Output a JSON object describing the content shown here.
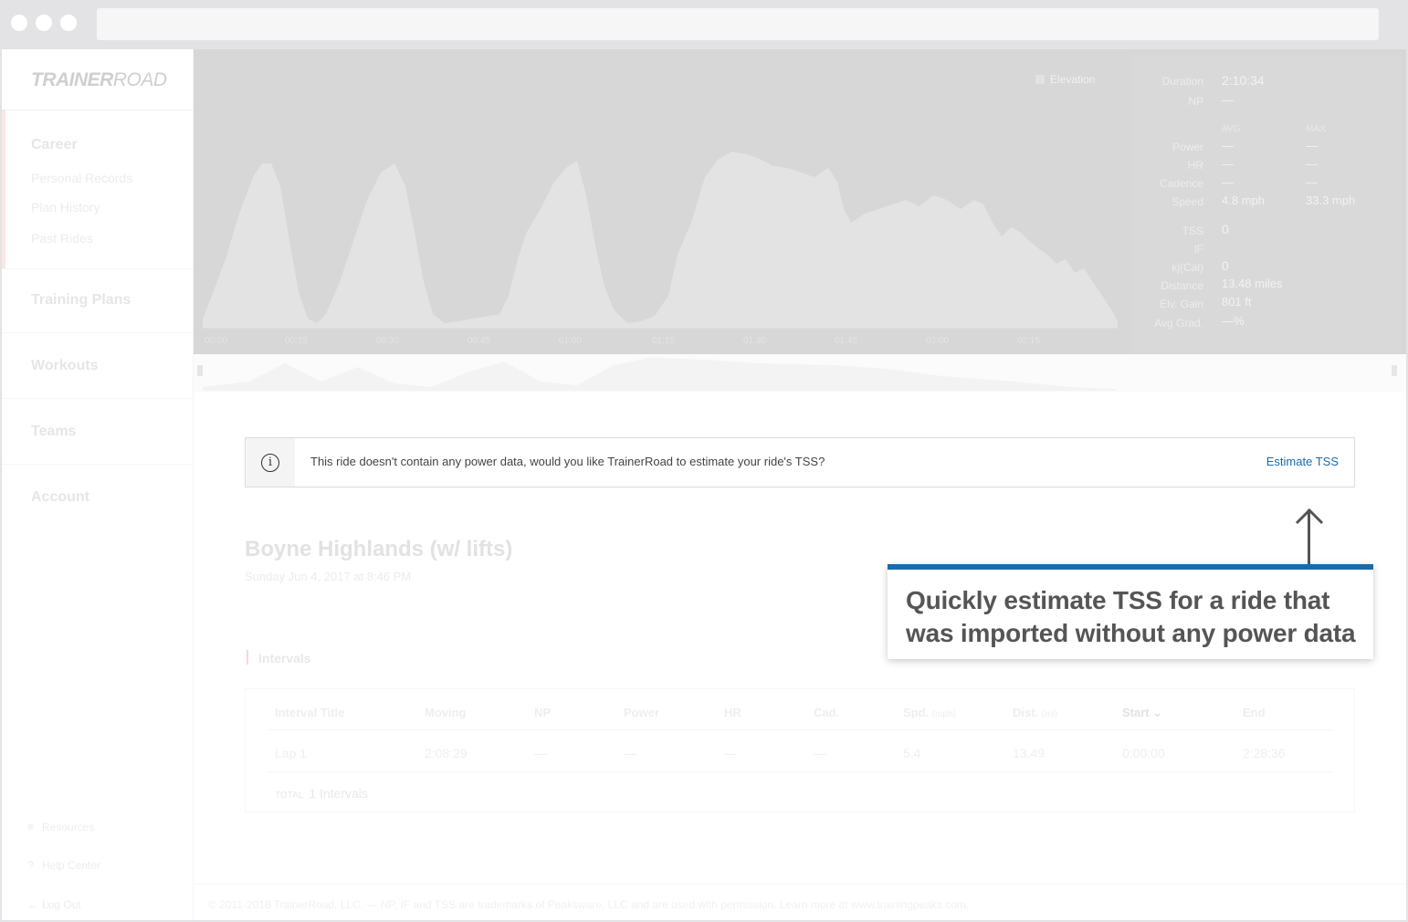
{
  "brand": {
    "logo_bold": "TRAINER",
    "logo_light": "ROAD"
  },
  "sidebar": {
    "career": "Career",
    "career_items": [
      "Personal Records",
      "Plan History",
      "Past Rides"
    ],
    "sections": [
      "Training Plans",
      "Workouts",
      "Teams",
      "Account"
    ],
    "bottom": [
      {
        "icon": "resources-icon",
        "label": "Resources"
      },
      {
        "icon": "help-icon",
        "label": "Help Center"
      },
      {
        "icon": "logout-icon",
        "label": "Log Out"
      }
    ]
  },
  "chart": {
    "legend": "Elevation",
    "time_ticks": [
      "00:00",
      "00:15",
      "00:30",
      "00:45",
      "01:00",
      "01:15",
      "01:30",
      "01:45",
      "02:00",
      "02:15"
    ]
  },
  "stats": {
    "duration_label": "Duration",
    "duration": "2:10:34",
    "np_label": "NP",
    "np": "—",
    "avg_head": "AVG",
    "max_head": "MAX",
    "rows": [
      {
        "label": "Power",
        "avg": "—",
        "max": "—"
      },
      {
        "label": "HR",
        "avg": "—",
        "max": "—"
      },
      {
        "label": "Cadence",
        "avg": "—",
        "max": "—"
      },
      {
        "label": "Speed",
        "avg": "4.8 mph",
        "max": "33.3 mph"
      }
    ],
    "tss_label": "TSS",
    "tss": "0",
    "if_label": "IF",
    "if": "",
    "kj_label": "kj(Cal)",
    "kj": "0",
    "distance_label": "Distance",
    "distance": "13.48 miles",
    "elv_label": "Elv. Gain",
    "elv": "801 ft",
    "grad_label": "Avg Grad.",
    "grad": "—%"
  },
  "notice": {
    "text": "This ride doesn't contain any power data, would you like TrainerRoad to estimate your ride's TSS?",
    "link": "Estimate TSS"
  },
  "ride": {
    "title": "Boyne Highlands (w/ lifts)",
    "date": "Sunday Jun 4, 2017 at 8:46 PM"
  },
  "intervals": {
    "label": "Intervals",
    "headers": [
      "Interval Title",
      "Moving",
      "NP",
      "Power",
      "HR",
      "Cad.",
      "Spd.",
      "Dist.",
      "Start",
      "End"
    ],
    "header_units": {
      "spd": "(mph)",
      "dist": "(mi)"
    },
    "row": [
      "Lap 1",
      "2:08:29",
      "—",
      "—",
      "—",
      "—",
      "5.4",
      "13.49",
      "0:00:00",
      "2:28:36"
    ],
    "total_label": "TOTAL",
    "total_value": "1 Intervals"
  },
  "footer": "© 2011-2018 TrainerRoad, LLC. — NP, IF and TSS are trademarks of Peaksware, LLC and are used with permission. Learn more at www.trainingpeaks.com.",
  "callout": {
    "text": "Quickly estimate TSS for a ride that was imported without any power data",
    "accent": "#1a6aab"
  }
}
